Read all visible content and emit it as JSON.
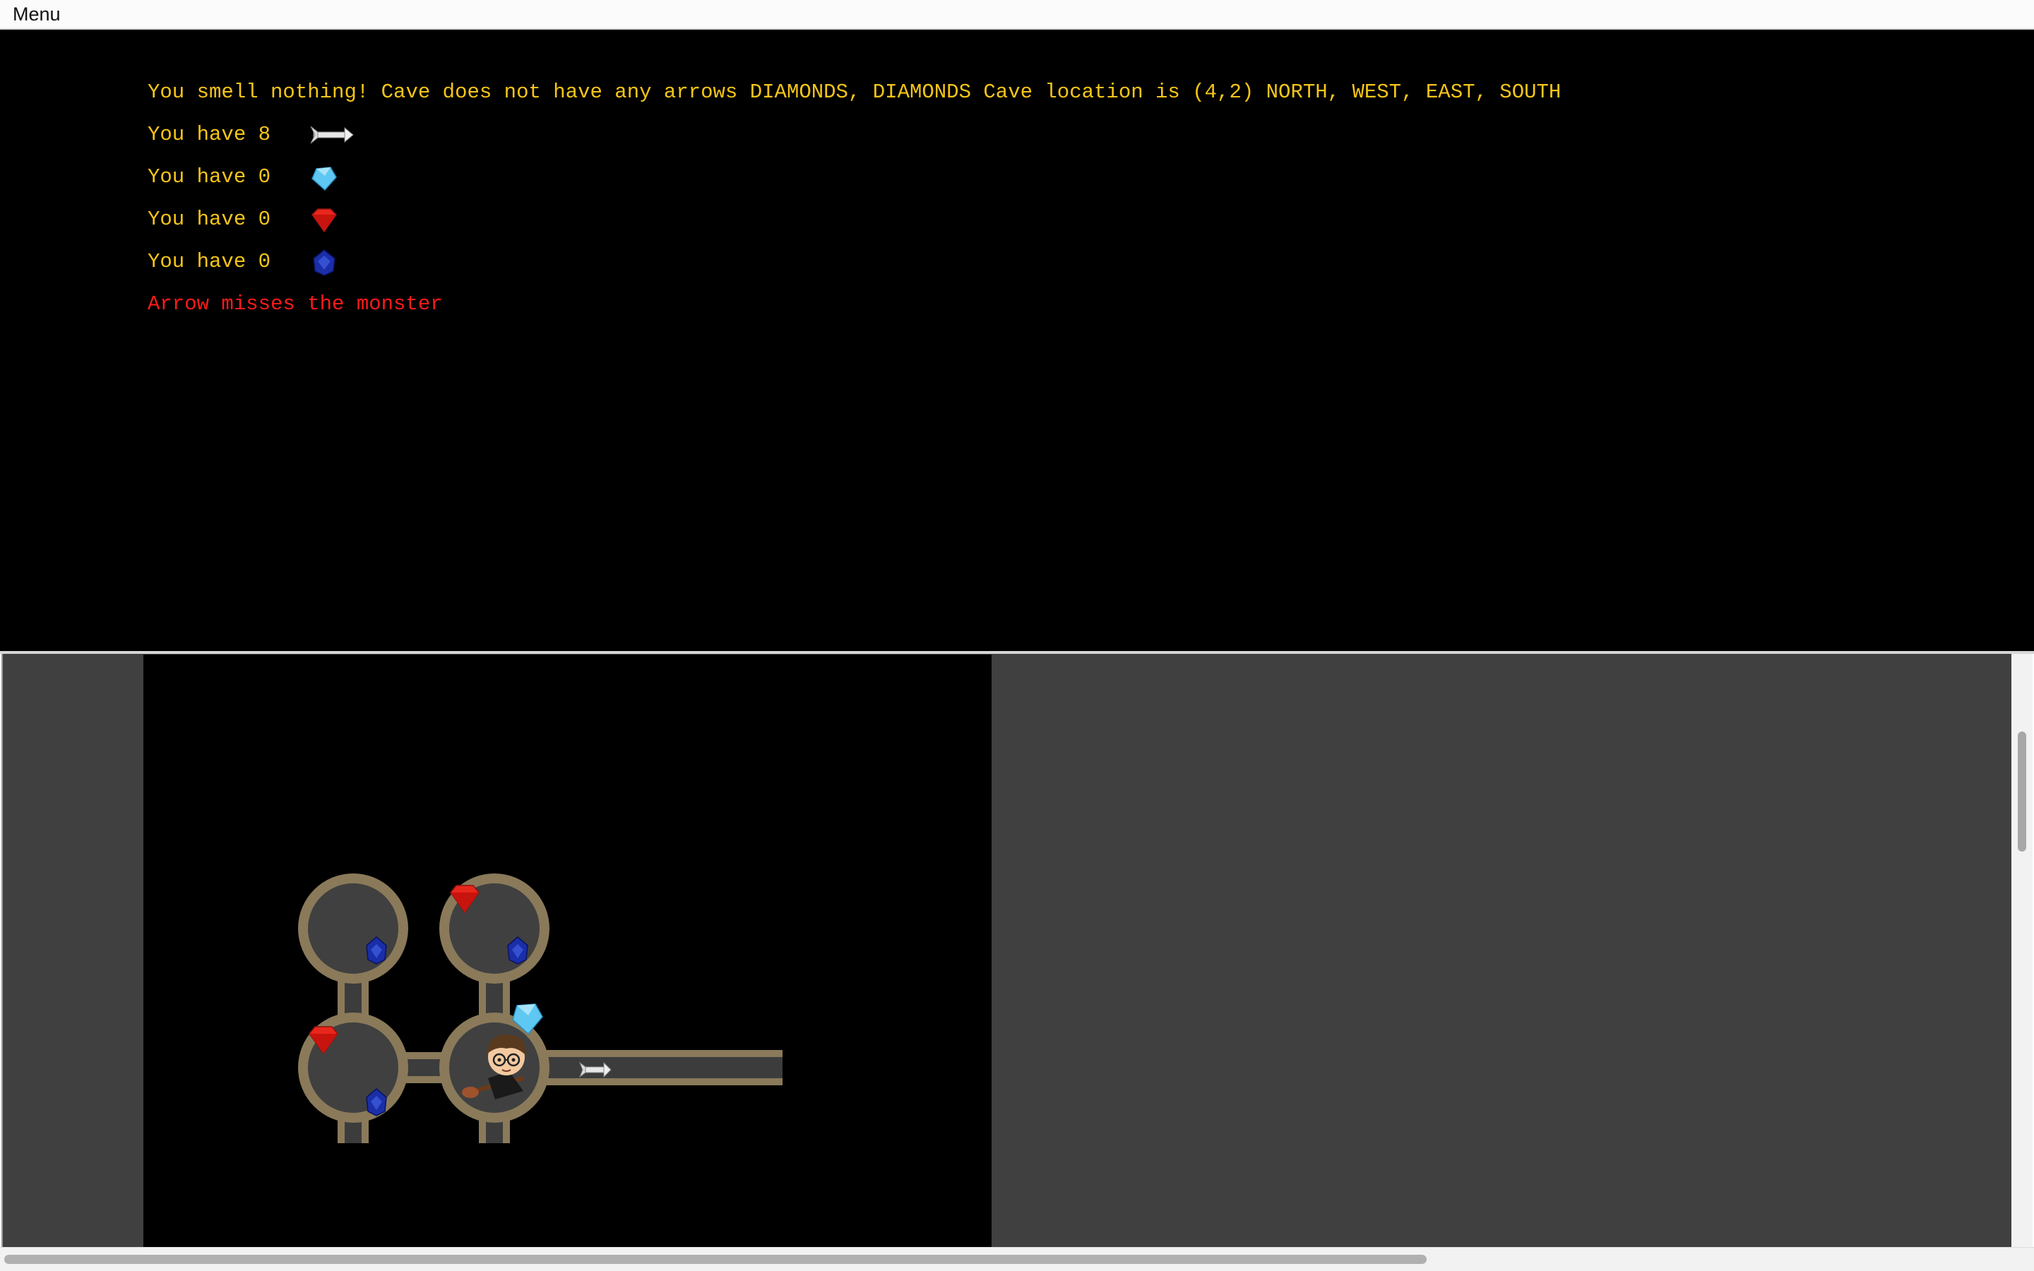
{
  "menubar": {
    "menu_label": "Menu"
  },
  "status": {
    "cave_info": "You smell nothing! Cave does not have any arrows DIAMONDS, DIAMONDS Cave location is (4,2) NORTH, WEST, EAST, SOUTH",
    "inventory": [
      {
        "label": "You have 8",
        "icon": "arrow-icon"
      },
      {
        "label": "You have 0",
        "icon": "diamond-icon"
      },
      {
        "label": "You have 0",
        "icon": "ruby-icon"
      },
      {
        "label": "You have 0",
        "icon": "sapphire-icon"
      }
    ],
    "message": "Arrow misses the monster"
  },
  "colors": {
    "text_yellow": "#f5c518",
    "message_red": "#ff1a1a",
    "map_background": "#000000",
    "viewport_background": "#404040"
  },
  "map": {
    "player_icon": "wizard-player-icon",
    "caves": [
      {
        "cell": "top-left",
        "items": [
          "sapphire"
        ]
      },
      {
        "cell": "top-right",
        "items": [
          "ruby",
          "sapphire",
          "diamond"
        ]
      },
      {
        "cell": "bottom-left",
        "items": [
          "ruby",
          "sapphire"
        ]
      },
      {
        "cell": "bottom-right",
        "items": [
          "player"
        ]
      },
      {
        "cell": "east-tunnel",
        "items": [
          "arrow"
        ]
      }
    ]
  }
}
